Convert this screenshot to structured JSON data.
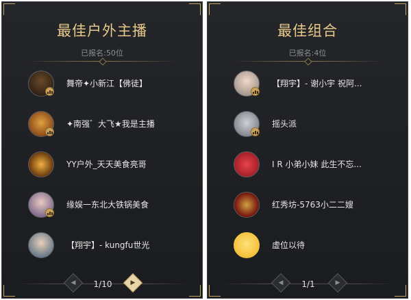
{
  "left_panel": {
    "title": "最佳户外主播",
    "count": "已报名:50位",
    "items": [
      {
        "name": "舞帝✦小新江【佛徒】",
        "avatar_icon": "streamer-avatar-1",
        "avatar_color": "#3a2a22"
      },
      {
        "name": "✦南强゛大飞★我是主播",
        "avatar_icon": "streamer-avatar-2",
        "avatar_color": "#8a4a1c"
      },
      {
        "name": "YY户外_天天美食亮哥",
        "avatar_icon": "streamer-avatar-3",
        "avatar_color": "#b06a20"
      },
      {
        "name": "缘娱一东北大铁锅美食",
        "avatar_icon": "streamer-avatar-4",
        "avatar_color": "#6a5a8a"
      },
      {
        "name": "【翔宇】- kungfu世光",
        "avatar_icon": "streamer-avatar-5",
        "avatar_color": "#4a6a8a"
      }
    ],
    "pager": {
      "text": "1/10",
      "prev_icon": "chevron-left-icon",
      "next_icon": "chevron-right-icon"
    }
  },
  "right_panel": {
    "title": "最佳组合",
    "count": "已报名:4位",
    "items": [
      {
        "name": "【翔宇】- 谢小宇 祝阿...",
        "avatar_icon": "group-avatar-1",
        "avatar_color": "#c8c0b8"
      },
      {
        "name": "摇头派",
        "avatar_icon": "group-avatar-2",
        "avatar_color": "#9a9aa0"
      },
      {
        "name": "I R 小弟小妹 此生不忘...",
        "avatar_icon": "group-avatar-3",
        "avatar_color": "#c0222a"
      },
      {
        "name": "红秀坊-5763小二二嫂",
        "avatar_icon": "group-avatar-4",
        "avatar_color": "#8a1a14"
      },
      {
        "name": "虚位以待",
        "avatar_icon": "placeholder-avatar",
        "avatar_color": "#f2c23a"
      }
    ],
    "pager": {
      "text": "1/1",
      "prev_icon": "chevron-left-icon",
      "next_icon": "chevron-right-icon"
    }
  },
  "colors": {
    "title_gold": "#e7c98a",
    "badge_gold": "#caa45d",
    "panel_bg": "#1e2023"
  }
}
